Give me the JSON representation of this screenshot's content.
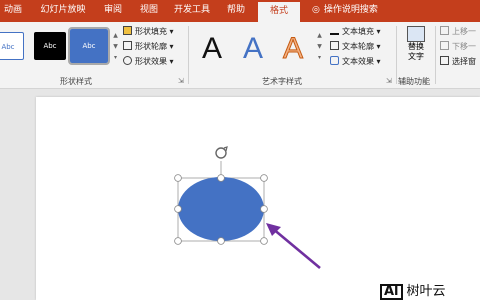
{
  "tabs": [
    {
      "label": "动画"
    },
    {
      "label": "幻灯片放映"
    },
    {
      "label": "审阅"
    },
    {
      "label": "视图"
    },
    {
      "label": "开发工具"
    },
    {
      "label": "帮助"
    },
    {
      "label": "格式",
      "active": true
    }
  ],
  "tell_me": "操作说明搜索",
  "shape_styles": {
    "thumbs": [
      "Abc",
      "Abc",
      "Abc"
    ],
    "fill": "形状填充",
    "outline": "形状轮廓",
    "effects": "形状效果",
    "group_label": "形状样式"
  },
  "wordart": {
    "letters": [
      "A",
      "A",
      "A"
    ],
    "text_fill": "文本填充",
    "text_outline": "文本轮廓",
    "text_effects": "文本效果",
    "group_label": "艺术字样式"
  },
  "accessibility": {
    "alt_text_line1": "替换",
    "alt_text_line2": "文字",
    "group_label": "辅助功能"
  },
  "arrange": {
    "bring_forward": "上移一",
    "send_backward": "下移一",
    "selection_pane": "选择窗"
  },
  "shape": {
    "fill_color": "#4472c4",
    "arrow_color": "#7030a0"
  },
  "watermark": {
    "box_text": "Al",
    "text": "树叶云"
  },
  "colors": {
    "accent": "#c43e1c"
  }
}
